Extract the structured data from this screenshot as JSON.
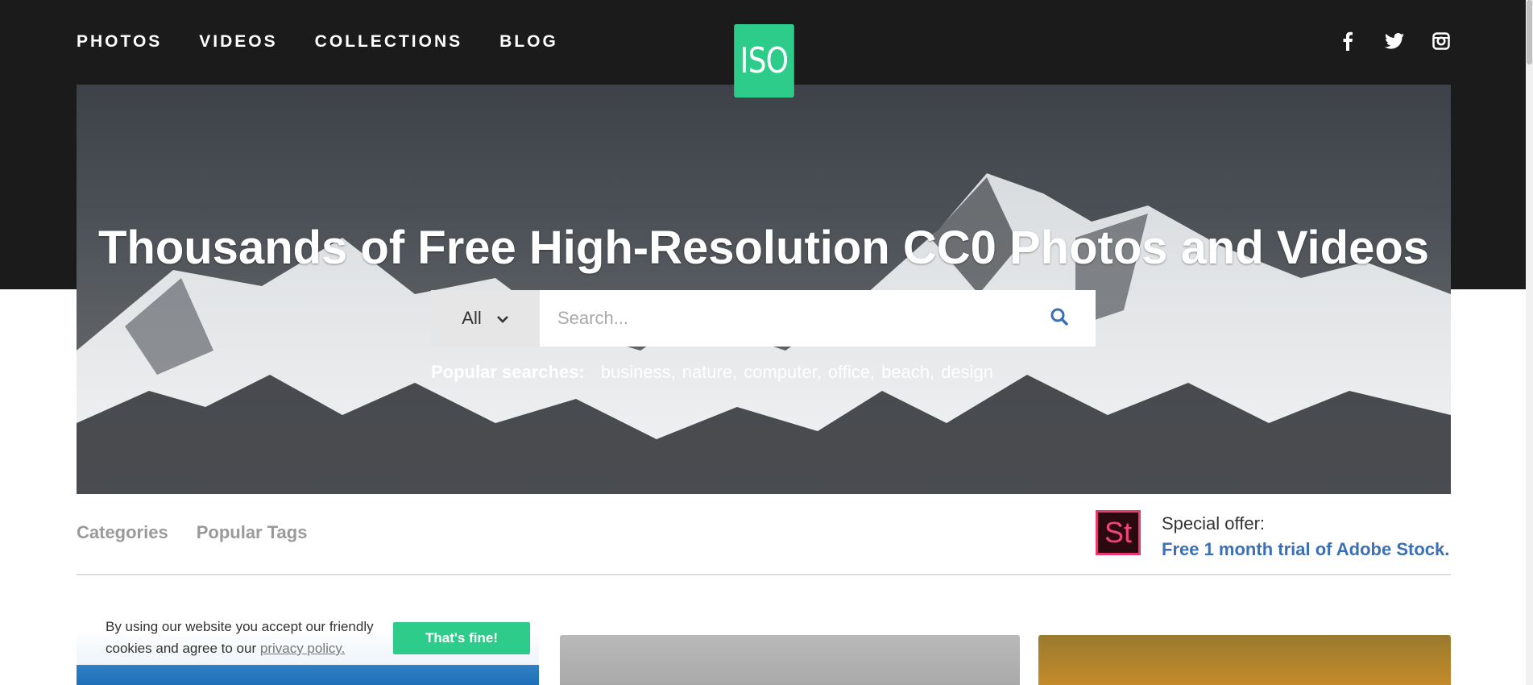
{
  "nav": {
    "items": [
      {
        "label": "PHOTOS"
      },
      {
        "label": "VIDEOS"
      },
      {
        "label": "COLLECTIONS"
      },
      {
        "label": "BLOG"
      }
    ]
  },
  "logo": {
    "text": "ISO",
    "color": "#2ecc8a"
  },
  "social": {
    "icons": [
      "facebook-icon",
      "twitter-icon",
      "instagram-icon"
    ]
  },
  "hero": {
    "title": "Thousands of Free High-Resolution CC0 Photos and Videos",
    "search": {
      "type_selected": "All",
      "placeholder": "Search...",
      "value": ""
    },
    "popular": {
      "label": "Popular searches:",
      "terms": [
        "business,",
        "nature,",
        "computer,",
        "office,",
        "beach,",
        "design"
      ]
    }
  },
  "tabs": {
    "items": [
      {
        "label": "Categories"
      },
      {
        "label": "Popular Tags"
      }
    ]
  },
  "offer": {
    "icon_text": "St",
    "line1": "Special offer:",
    "line2": "Free 1 month trial of Adobe Stock.",
    "link_color": "#3b6fb6"
  },
  "cookie": {
    "text_before": "By using our website you accept our friendly cookies and agree to our ",
    "link": "privacy policy.",
    "button": "That's fine!"
  }
}
